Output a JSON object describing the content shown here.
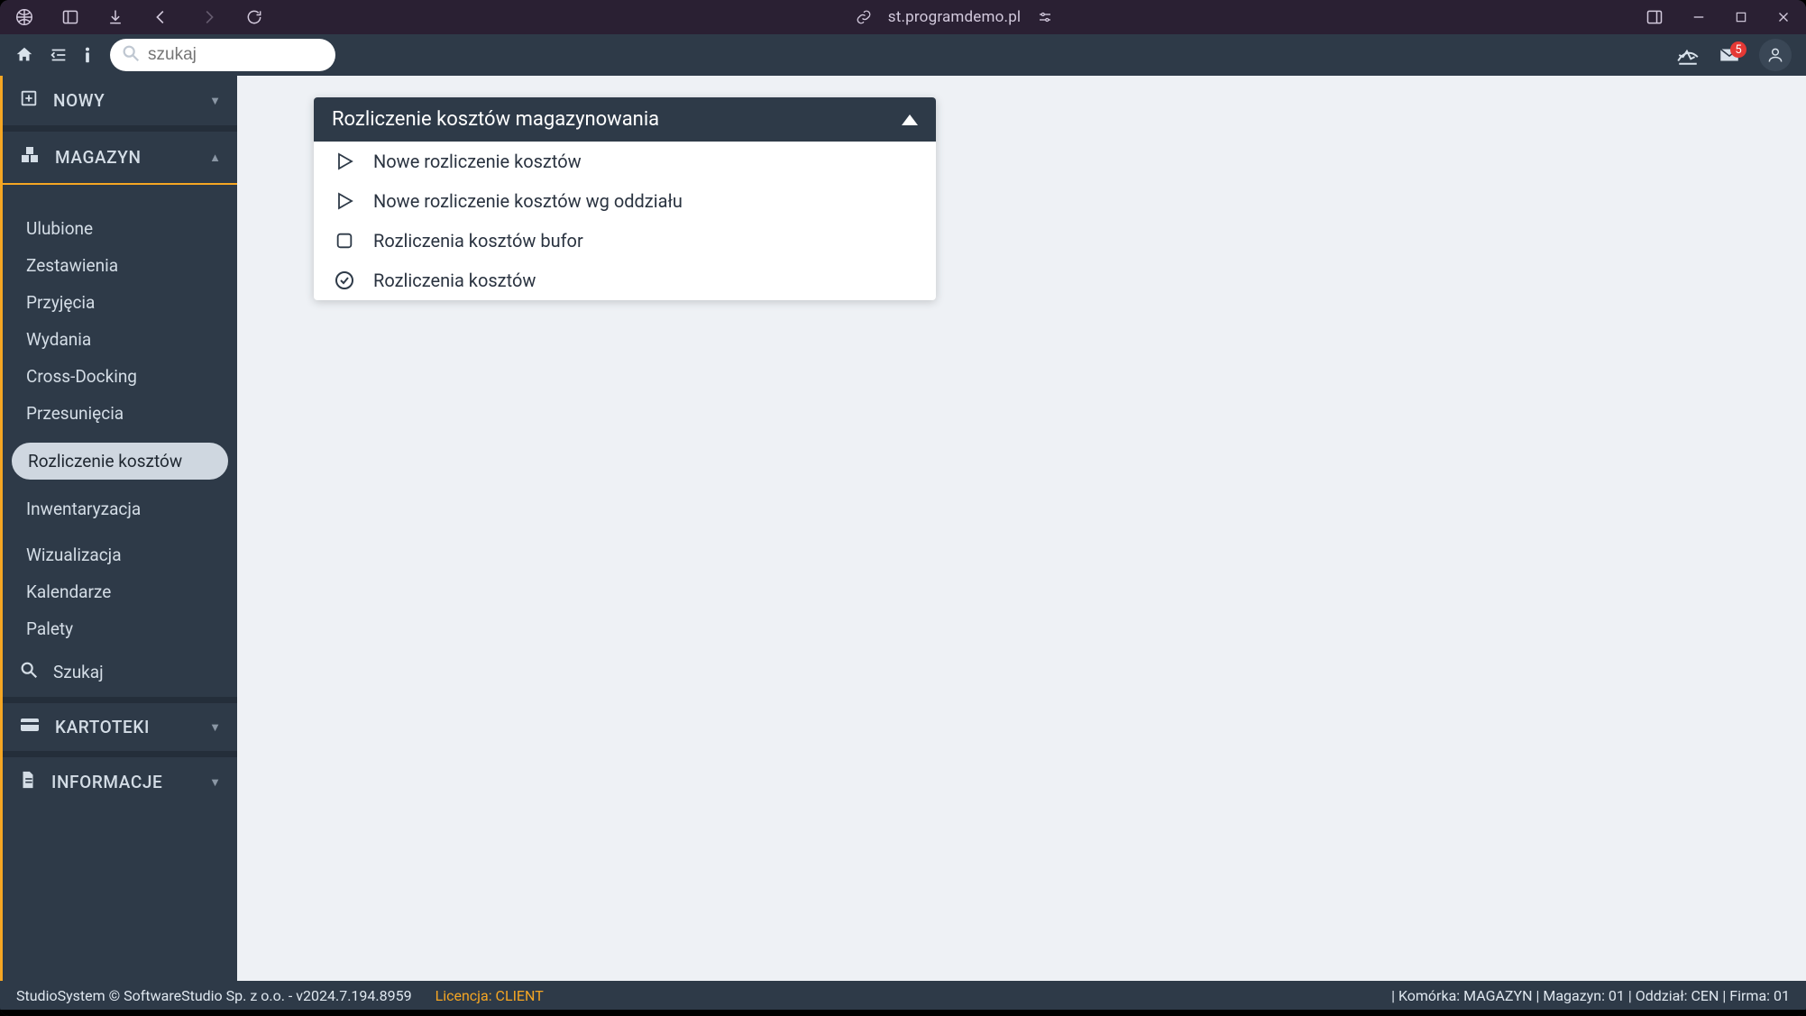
{
  "titlebar": {
    "url": "st.programdemo.pl"
  },
  "appbar": {
    "search_placeholder": "szukaj",
    "notif_count": "5"
  },
  "sidebar": {
    "sections": {
      "nowy": "NOWY",
      "magazyn": "MAGAZYN",
      "kartoteki": "KARTOTEKI",
      "informacje": "INFORMACJE"
    },
    "magazyn_items": [
      "Ulubione",
      "Zestawienia",
      "Przyjęcia",
      "Wydania",
      "Cross-Docking",
      "Przesunięcia"
    ],
    "magazyn_selected": "Rozliczenie kosztów",
    "magazyn_items2": [
      "Inwentaryzacja"
    ],
    "magazyn_items3": [
      "Wizualizacja",
      "Kalendarze",
      "Palety"
    ],
    "search_label": "Szukaj"
  },
  "panel": {
    "title": "Rozliczenie kosztów magazynowania",
    "items": [
      {
        "icon": "play",
        "label": "Nowe rozliczenie kosztów"
      },
      {
        "icon": "play",
        "label": "Nowe rozliczenie kosztów wg oddziału"
      },
      {
        "icon": "square",
        "label": "Rozliczenia kosztów bufor"
      },
      {
        "icon": "check-circle",
        "label": "Rozliczenia kosztów"
      }
    ]
  },
  "status": {
    "left": "StudioSystem © SoftwareStudio Sp. z o.o. - v2024.7.194.8959",
    "license_label": "Licencja: CLIENT",
    "segments": "| Komórka: MAGAZYN | Magazyn: 01 | Oddział: CEN | Firma: 01"
  }
}
